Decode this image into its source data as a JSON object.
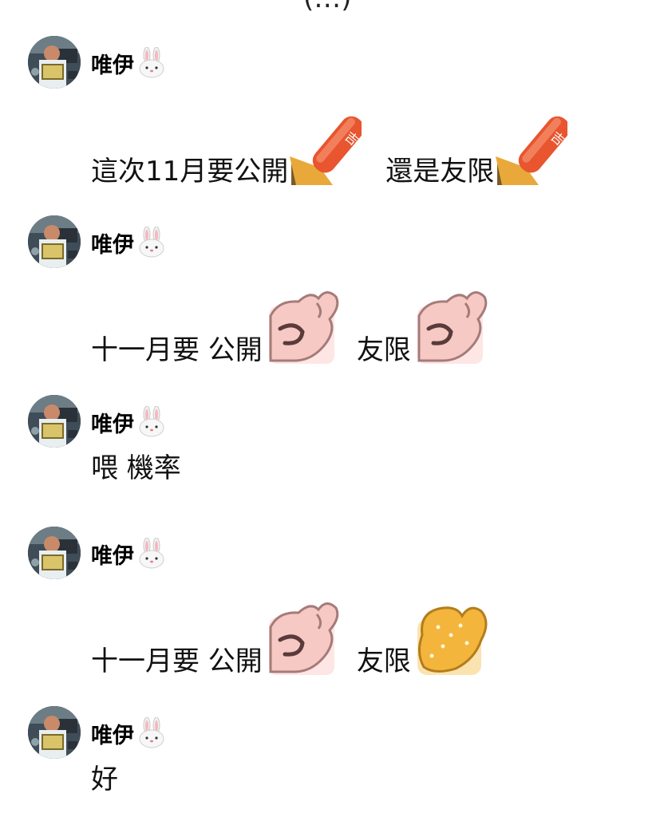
{
  "top_fragment": "(…)",
  "username": "唯伊",
  "username_emoji": "rabbit-face-icon",
  "messages": [
    {
      "parts": [
        {
          "text": "這次11月要公開"
        },
        {
          "sticker": "red-stamp-sticker"
        },
        {
          "text": "還是友限"
        },
        {
          "sticker": "red-stamp-sticker"
        }
      ]
    },
    {
      "parts": [
        {
          "text": "十一月要 公開"
        },
        {
          "sticker": "ok-hand-sticker"
        },
        {
          "text": "友限"
        },
        {
          "sticker": "ok-hand-sticker"
        }
      ]
    },
    {
      "parts": [
        {
          "text": "喂 機率"
        }
      ]
    },
    {
      "parts": [
        {
          "text": "十一月要 公開"
        },
        {
          "sticker": "ok-hand-sticker"
        },
        {
          "text": "友限"
        },
        {
          "sticker": "yellow-paw-sticker"
        }
      ]
    },
    {
      "parts": [
        {
          "text": "好"
        }
      ]
    }
  ],
  "colors": {
    "stamp_red": "#e8552f",
    "stamp_base": "#e9a93a",
    "hand_pink": "#f6c9c4",
    "paw_yellow": "#f3b53b"
  }
}
